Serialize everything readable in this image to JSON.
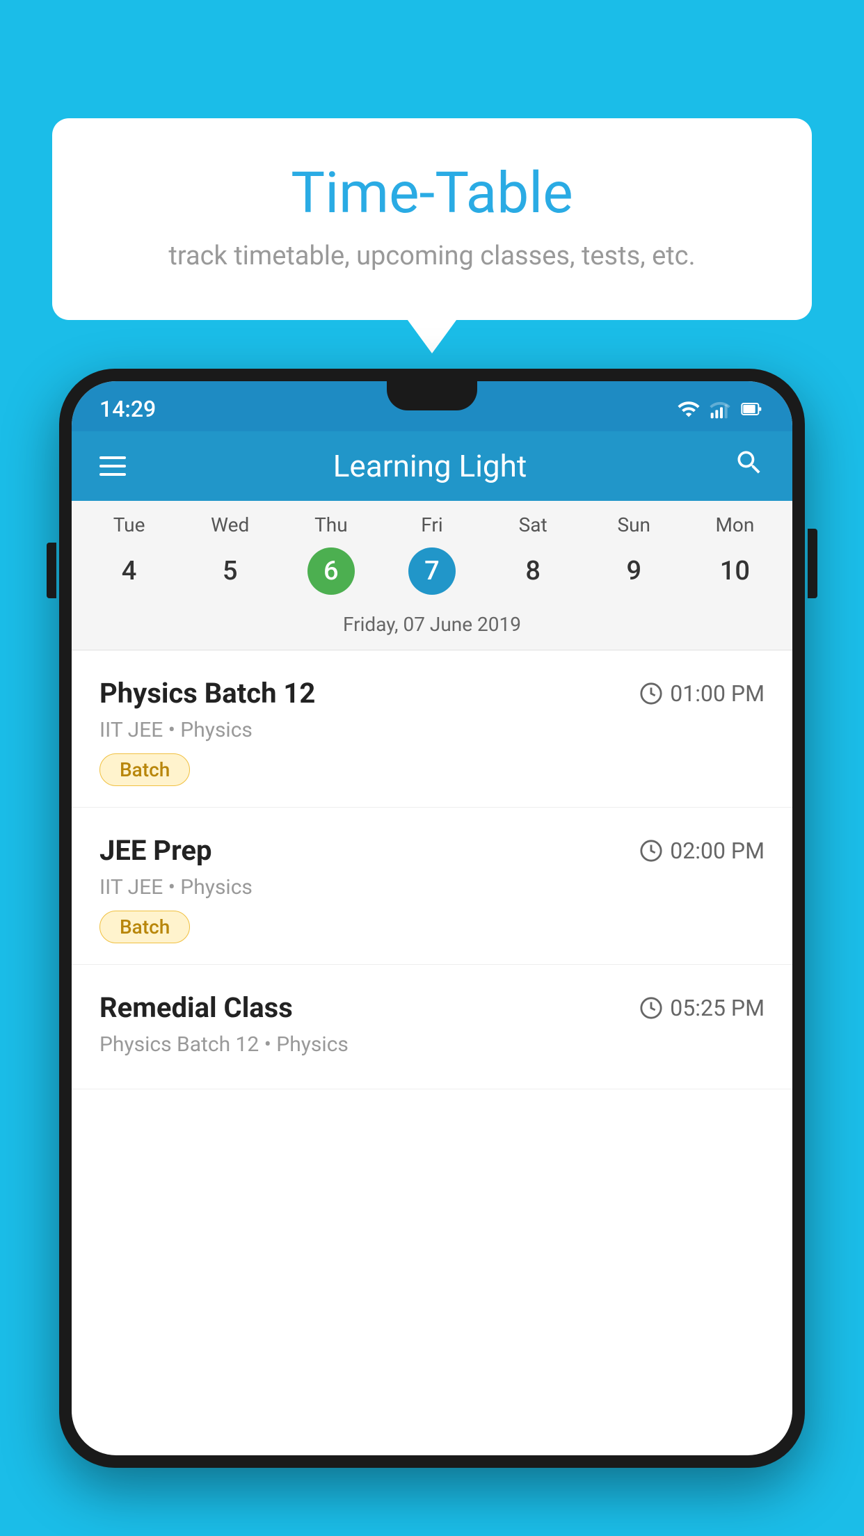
{
  "page": {
    "background_color": "#1BBDE8"
  },
  "speech_bubble": {
    "title": "Time-Table",
    "subtitle": "track timetable, upcoming classes, tests, etc."
  },
  "status_bar": {
    "time": "14:29"
  },
  "app_bar": {
    "title": "Learning Light"
  },
  "calendar": {
    "days": [
      "Tue",
      "Wed",
      "Thu",
      "Fri",
      "Sat",
      "Sun",
      "Mon"
    ],
    "dates": [
      {
        "number": "4",
        "state": "normal"
      },
      {
        "number": "5",
        "state": "normal"
      },
      {
        "number": "6",
        "state": "today"
      },
      {
        "number": "7",
        "state": "selected"
      },
      {
        "number": "8",
        "state": "normal"
      },
      {
        "number": "9",
        "state": "normal"
      },
      {
        "number": "10",
        "state": "normal"
      }
    ],
    "selected_date_label": "Friday, 07 June 2019"
  },
  "schedule": {
    "items": [
      {
        "title": "Physics Batch 12",
        "time": "01:00 PM",
        "subtitle": "IIT JEE • Physics",
        "tag": "Batch"
      },
      {
        "title": "JEE Prep",
        "time": "02:00 PM",
        "subtitle": "IIT JEE • Physics",
        "tag": "Batch"
      },
      {
        "title": "Remedial Class",
        "time": "05:25 PM",
        "subtitle": "Physics Batch 12 • Physics",
        "tag": ""
      }
    ]
  }
}
